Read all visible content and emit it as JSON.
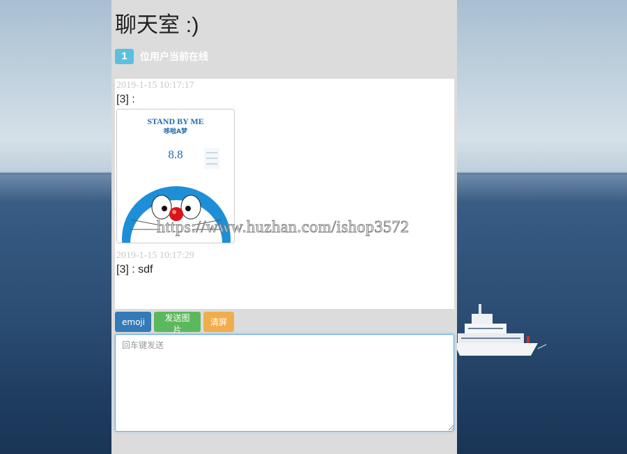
{
  "page": {
    "title": "聊天室 :)"
  },
  "online": {
    "count": "1",
    "label": "位用户当前在线"
  },
  "messages": [
    {
      "time": "2019-1-15 10:17:17",
      "text": "[3] :",
      "image": {
        "title": "STAND BY ME",
        "subtitle": "哆啦A梦",
        "date": "8.8"
      }
    },
    {
      "time": "2019-1-15 10:17:29",
      "text": "[3] : sdf"
    }
  ],
  "toolbar": {
    "emoji_label": "emoji",
    "send_image_label": "发送图片",
    "clear_label": "清屏"
  },
  "input": {
    "placeholder": "回车键发送"
  },
  "watermark": "https://www.huzhan.com/ishop3572",
  "colors": {
    "emoji": "#337ab7",
    "send_image": "#5cb85c",
    "clear": "#f0ad4e",
    "badge": "#5bc0de"
  }
}
